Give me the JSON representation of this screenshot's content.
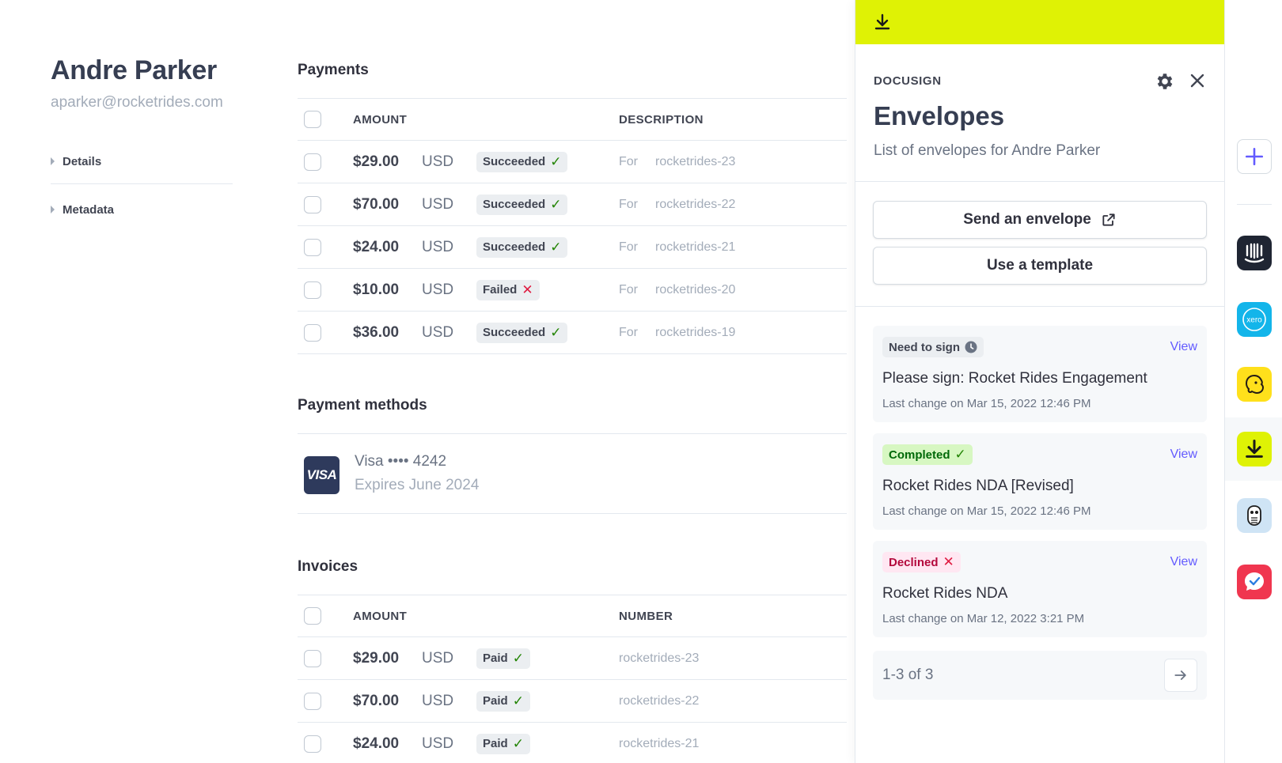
{
  "customer": {
    "name": "Andre Parker",
    "email": "aparker@rocketrides.com",
    "sections": [
      "Details",
      "Metadata"
    ]
  },
  "payments": {
    "title": "Payments",
    "columns": {
      "amount": "AMOUNT",
      "description": "DESCRIPTION"
    },
    "rows": [
      {
        "amount": "$29.00",
        "currency": "USD",
        "status": "Succeeded",
        "ok": true,
        "for": "For",
        "desc": "rocketrides-23"
      },
      {
        "amount": "$70.00",
        "currency": "USD",
        "status": "Succeeded",
        "ok": true,
        "for": "For",
        "desc": "rocketrides-22"
      },
      {
        "amount": "$24.00",
        "currency": "USD",
        "status": "Succeeded",
        "ok": true,
        "for": "For",
        "desc": "rocketrides-21"
      },
      {
        "amount": "$10.00",
        "currency": "USD",
        "status": "Failed",
        "ok": false,
        "for": "For",
        "desc": "rocketrides-20"
      },
      {
        "amount": "$36.00",
        "currency": "USD",
        "status": "Succeeded",
        "ok": true,
        "for": "For",
        "desc": "rocketrides-19"
      }
    ]
  },
  "payment_methods": {
    "title": "Payment methods",
    "card": {
      "brand_logo": "VISA",
      "label": "Visa •••• 4242",
      "expires": "Expires June 2024"
    }
  },
  "invoices": {
    "title": "Invoices",
    "columns": {
      "amount": "AMOUNT",
      "number": "NUMBER"
    },
    "rows": [
      {
        "amount": "$29.00",
        "currency": "USD",
        "status": "Paid",
        "number": "rocketrides-23"
      },
      {
        "amount": "$70.00",
        "currency": "USD",
        "status": "Paid",
        "number": "rocketrides-22"
      },
      {
        "amount": "$24.00",
        "currency": "USD",
        "status": "Paid",
        "number": "rocketrides-21"
      }
    ]
  },
  "panel": {
    "app_name": "DOCUSIGN",
    "title": "Envelopes",
    "subtitle": "List of envelopes for Andre Parker",
    "send_button": "Send an envelope",
    "template_button": "Use a template",
    "envelopes": [
      {
        "status": "Need to sign",
        "kind": "need",
        "view": "View",
        "title": "Please sign: Rocket Rides Engagement",
        "meta": "Last change on Mar 15, 2022 12:46 PM"
      },
      {
        "status": "Completed",
        "kind": "done",
        "view": "View",
        "title": "Rocket Rides NDA [Revised]",
        "meta": "Last change on Mar 15, 2022 12:46 PM"
      },
      {
        "status": "Declined",
        "kind": "decl",
        "view": "View",
        "title": "Rocket Rides NDA",
        "meta": "Last change on Mar 12, 2022 3:21 PM"
      }
    ],
    "pagination": "1-3 of 3"
  },
  "rail": {
    "apps": [
      "intercom-icon",
      "xero-icon",
      "mailchimp-icon",
      "docusign-icon",
      "hootsuite-icon",
      "checkmark-chat-icon"
    ],
    "xero_label": "xero"
  },
  "colors": {
    "accent": "#635bff",
    "docusign_yellow": "#dff205",
    "success": "#228403",
    "danger": "#df1b41"
  }
}
